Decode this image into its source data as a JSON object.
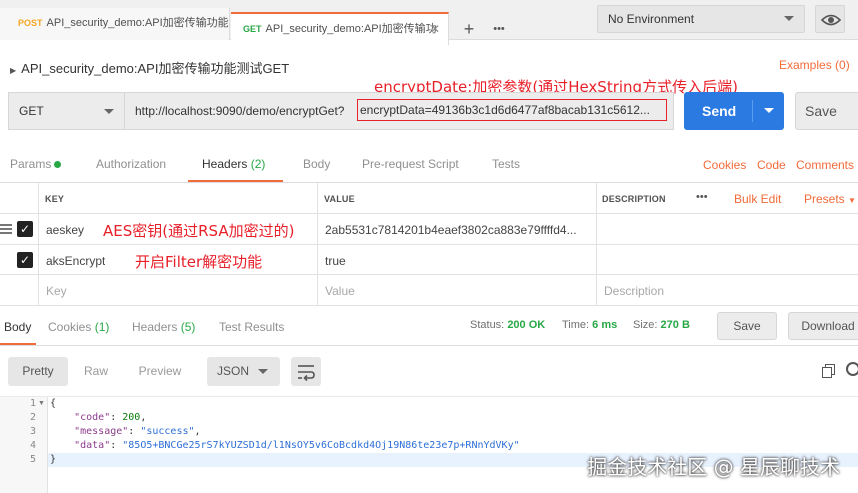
{
  "tabs": [
    {
      "method": "POST",
      "method_color": "#f5a623",
      "title": "API_security_demo:API加密传输功能"
    },
    {
      "method": "GET",
      "method_color": "#28a745",
      "title": "API_security_demo:API加密传输功",
      "close": "✕"
    }
  ],
  "environment": {
    "selected": "No Environment"
  },
  "request": {
    "name": "API_security_demo:API加密传输功能测试GET",
    "examples_label": "Examples (0)",
    "method": "GET",
    "url": "http://localhost:9090/demo/encryptGet?",
    "url_param": "encryptData=49136b3c1d6d6477af8bacab131c5612...",
    "send_label": "Send",
    "save_label": "Save"
  },
  "annotations": {
    "encrypt_date": "encryptDate:加密参数(通过HexString方式传入后端)",
    "aeskey": "AES密钥(通过RSA加密过的)",
    "filter": "开启Filter解密功能"
  },
  "request_tabs": {
    "params": "Params",
    "authorization": "Authorization",
    "headers": "Headers",
    "headers_count": "(2)",
    "body": "Body",
    "prerequest": "Pre-request Script",
    "tests": "Tests",
    "cookies": "Cookies",
    "code": "Code",
    "comments": "Comments"
  },
  "headers_table": {
    "col_key": "KEY",
    "col_value": "VALUE",
    "col_description": "DESCRIPTION",
    "more": "•••",
    "bulk_edit": "Bulk Edit",
    "presets": "Presets",
    "rows": [
      {
        "key": "aeskey",
        "value": "2ab5531c7814201b4eaef3802ca883e79ffffd4..."
      },
      {
        "key": "aksEncrypt",
        "value": "true"
      }
    ],
    "placeholder_key": "Key",
    "placeholder_value": "Value",
    "placeholder_description": "Description"
  },
  "response_tabs": {
    "body": "Body",
    "cookies": "Cookies",
    "cookies_count": "(1)",
    "headers": "Headers",
    "headers_count": "(5)",
    "test_results": "Test Results"
  },
  "response_status": {
    "status_label": "Status:",
    "status_value": "200 OK",
    "time_label": "Time:",
    "time_value": "6 ms",
    "size_label": "Size:",
    "size_value": "270 B",
    "save_label": "Save",
    "download_label": "Download"
  },
  "view_controls": {
    "pretty": "Pretty",
    "raw": "Raw",
    "preview": "Preview",
    "format": "JSON"
  },
  "code": {
    "line_numbers": [
      "1",
      "2",
      "3",
      "4",
      "5"
    ],
    "open": "{",
    "code_key": "\"code\"",
    "code_val": "200",
    "message_key": "\"message\"",
    "message_val": "\"success\"",
    "data_key": "\"data\"",
    "data_val": "\"85O5+BNCGe25rS7kYUZSD1d/l1NsOY5v6CoBcdkd4Oj19N86te23e7p+RNnYdVKy\"",
    "close": "}"
  },
  "watermark": "掘金技术社区 @ 星辰聊技术"
}
